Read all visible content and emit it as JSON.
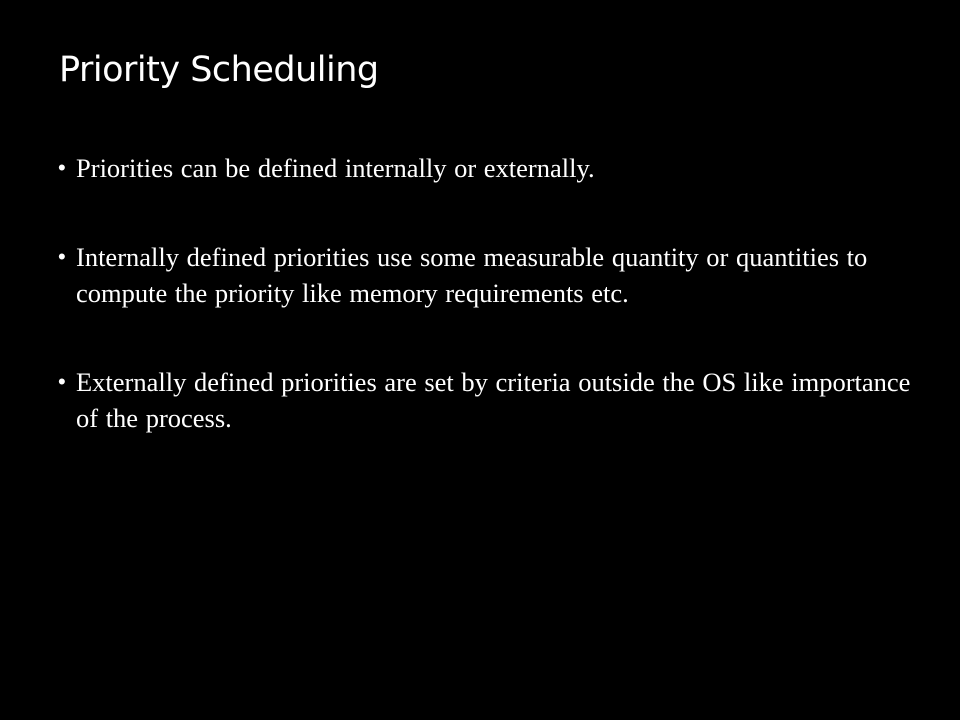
{
  "slide": {
    "title": "Priority Scheduling",
    "bullet_marker": "•",
    "bullets": [
      {
        "text": "Priorities can be defined internally or externally."
      },
      {
        "text": "Internally defined priorities use some measurable quantity or quantities to compute the priority like memory requirements etc."
      },
      {
        "text": "Externally defined priorities are set by criteria outside the OS like importance of the process."
      }
    ]
  },
  "colors": {
    "background": "#000000",
    "text": "#ffffff"
  }
}
